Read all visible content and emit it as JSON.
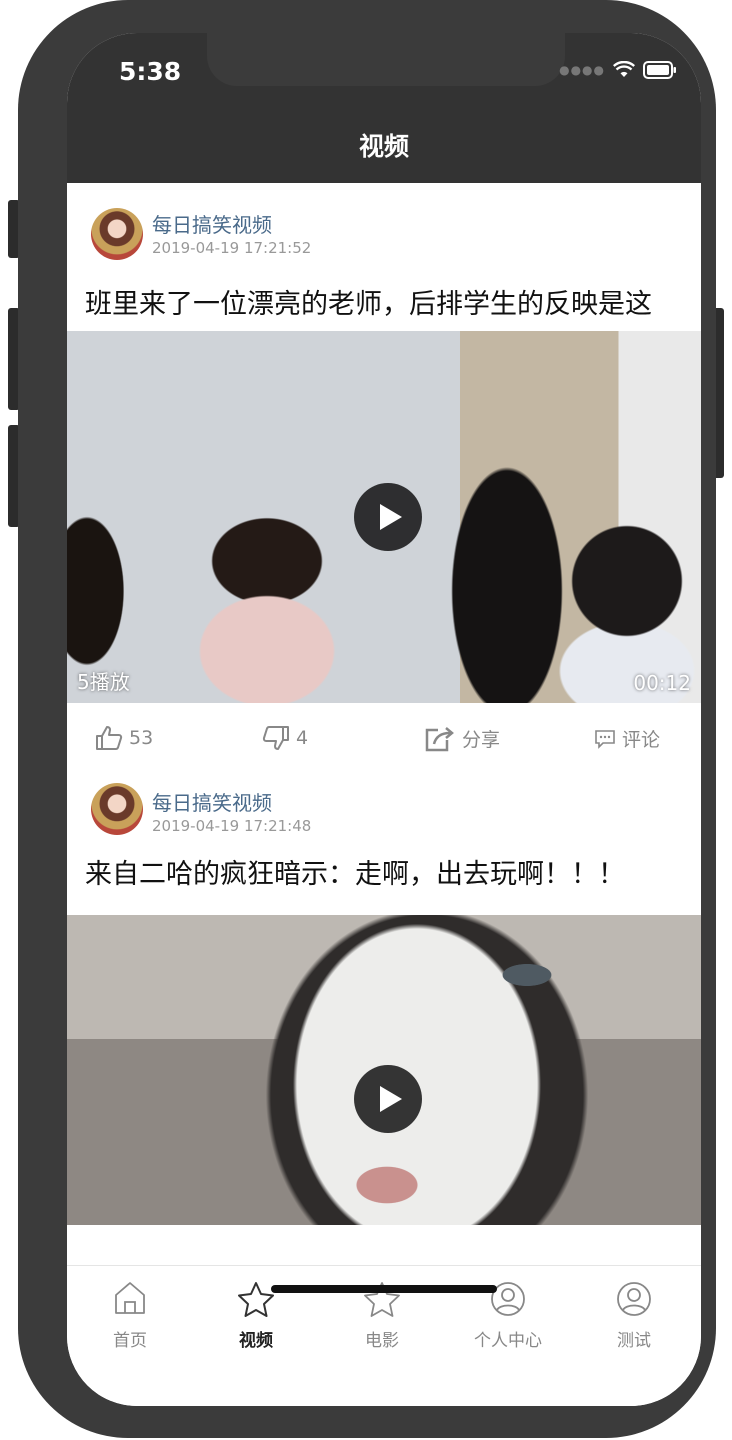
{
  "status_bar": {
    "time": "5:38"
  },
  "nav": {
    "title": "视频"
  },
  "posts": [
    {
      "author": "每日搞笑视频",
      "time": "2019-04-19 17:21:52",
      "title": "班里来了一位漂亮的老师，后排学生的反映是这",
      "plays": "5播放",
      "duration": "00:12",
      "likes": "53",
      "dislikes": "4",
      "share_label": "分享",
      "comment_label": "评论"
    },
    {
      "author": "每日搞笑视频",
      "time": "2019-04-19 17:21:48",
      "title": "来自二哈的疯狂暗示：走啊，出去玩啊！！！"
    }
  ],
  "tabbar": {
    "items": [
      {
        "label": "首页",
        "icon": "home-icon",
        "active": false
      },
      {
        "label": "视频",
        "icon": "star-icon",
        "active": true
      },
      {
        "label": "电影",
        "icon": "star-icon",
        "active": false
      },
      {
        "label": "个人中心",
        "icon": "user-icon",
        "active": false
      },
      {
        "label": "测试",
        "icon": "user-icon",
        "active": false
      }
    ]
  },
  "colors": {
    "nav_bg": "#333333",
    "author": "#4a6a8a",
    "frame": "#3b3b3b"
  }
}
